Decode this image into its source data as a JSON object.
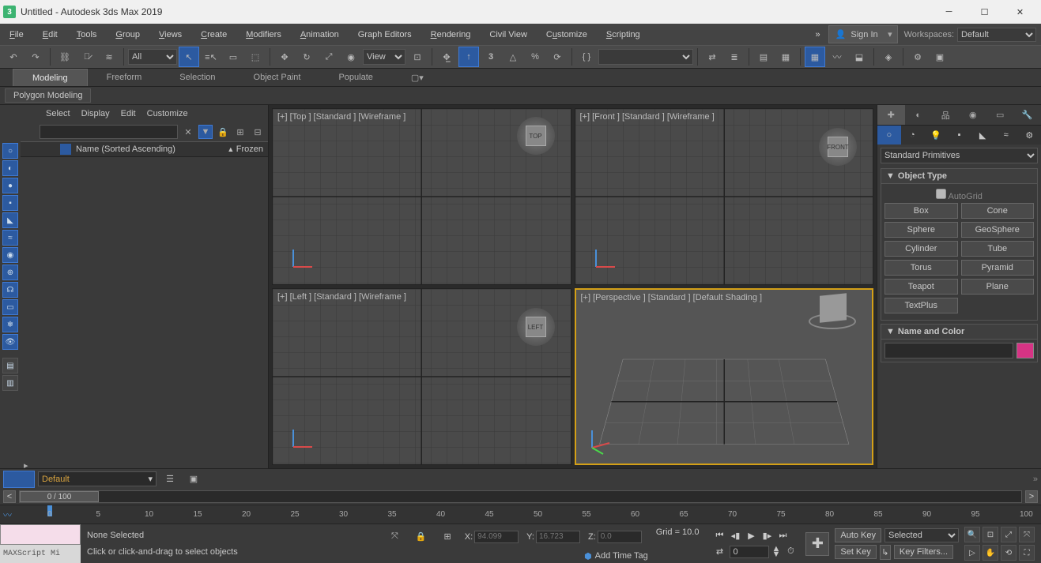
{
  "window": {
    "title": "Untitled - Autodesk 3ds Max 2019"
  },
  "menu": {
    "items": [
      "File",
      "Edit",
      "Tools",
      "Group",
      "Views",
      "Create",
      "Modifiers",
      "Animation",
      "Graph Editors",
      "Rendering",
      "Civil View",
      "Customize",
      "Scripting"
    ],
    "signin": "Sign In",
    "workspaces_label": "Workspaces:",
    "workspaces_value": "Default"
  },
  "toolbar": {
    "selection_set": "All",
    "ref_coord": "View"
  },
  "ribbon": {
    "tabs": [
      "Modeling",
      "Freeform",
      "Selection",
      "Object Paint",
      "Populate"
    ],
    "active": 0,
    "sub": "Polygon Modeling"
  },
  "scene": {
    "menu": [
      "Select",
      "Display",
      "Edit",
      "Customize"
    ],
    "columns": {
      "name": "Name (Sorted Ascending)",
      "frozen": "Frozen"
    }
  },
  "viewports": {
    "v0": {
      "label": "[+] [Top ] [Standard ] [Wireframe ]",
      "cube": "TOP"
    },
    "v1": {
      "label": "[+] [Front ] [Standard ] [Wireframe ]",
      "cube": "FRONT"
    },
    "v2": {
      "label": "[+] [Left ] [Standard ] [Wireframe ]",
      "cube": "LEFT"
    },
    "v3": {
      "label": "[+] [Perspective ] [Standard ] [Default Shading ]"
    }
  },
  "cmdpanel": {
    "dropdown": "Standard Primitives",
    "object_type_hdr": "Object Type",
    "autogrid": "AutoGrid",
    "buttons": [
      [
        "Box",
        "Cone"
      ],
      [
        "Sphere",
        "GeoSphere"
      ],
      [
        "Cylinder",
        "Tube"
      ],
      [
        "Torus",
        "Pyramid"
      ],
      [
        "Teapot",
        "Plane"
      ],
      [
        "TextPlus",
        ""
      ]
    ],
    "name_color_hdr": "Name and Color"
  },
  "layer": {
    "default": "Default"
  },
  "timeslider": {
    "frame": "0 / 100"
  },
  "ruler": {
    "ticks": [
      0,
      5,
      10,
      15,
      20,
      25,
      30,
      35,
      40,
      45,
      50,
      55,
      60,
      65,
      70,
      75,
      80,
      85,
      90,
      95,
      100
    ]
  },
  "status": {
    "maxscript": "MAXScript Mi",
    "none_selected": "None Selected",
    "hint": "Click or click-and-drag to select objects",
    "x_label": "X:",
    "x_val": "94.099",
    "y_label": "Y:",
    "y_val": "16.723",
    "z_label": "Z:",
    "z_val": "0.0",
    "grid": "Grid = 10.0",
    "add_time_tag": "Add Time Tag",
    "frame_val": "0",
    "autokey": "Auto Key",
    "setkey": "Set Key",
    "selected": "Selected",
    "keyfilters": "Key Filters..."
  }
}
